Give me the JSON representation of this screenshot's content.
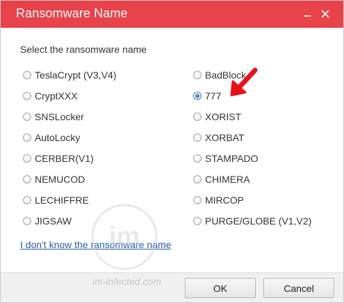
{
  "window": {
    "title": "Ransomware Name",
    "title_color": "#e8424a",
    "minimize_icon": "minimize-icon",
    "close_icon": "close-icon"
  },
  "prompt": "Select the ransomware name",
  "options_left": [
    {
      "label": "TeslaCrypt (V3,V4)",
      "checked": false
    },
    {
      "label": "CryptXXX",
      "checked": false
    },
    {
      "label": "SNSLocker",
      "checked": false
    },
    {
      "label": "AutoLocky",
      "checked": false
    },
    {
      "label": "CERBER(V1)",
      "checked": false
    },
    {
      "label": "NEMUCOD",
      "checked": false
    },
    {
      "label": "LECHIFFRE",
      "checked": false
    },
    {
      "label": "JIGSAW",
      "checked": false
    }
  ],
  "options_right": [
    {
      "label": "BadBlock",
      "checked": false
    },
    {
      "label": "777",
      "checked": true
    },
    {
      "label": "XORIST",
      "checked": false
    },
    {
      "label": "XORBAT",
      "checked": false
    },
    {
      "label": "STAMPADO",
      "checked": false
    },
    {
      "label": "CHIMERA",
      "checked": false
    },
    {
      "label": "MIRCOP",
      "checked": false
    },
    {
      "label": "PURGE/GLOBE (V1,V2)",
      "checked": false
    }
  ],
  "link": "I don't know the ransomware name",
  "buttons": {
    "ok": "OK",
    "cancel": "Cancel"
  },
  "watermark": {
    "logo_text": "im",
    "site_text": "im-infected.com"
  },
  "annotation": {
    "arrow_color": "#e8101a"
  }
}
